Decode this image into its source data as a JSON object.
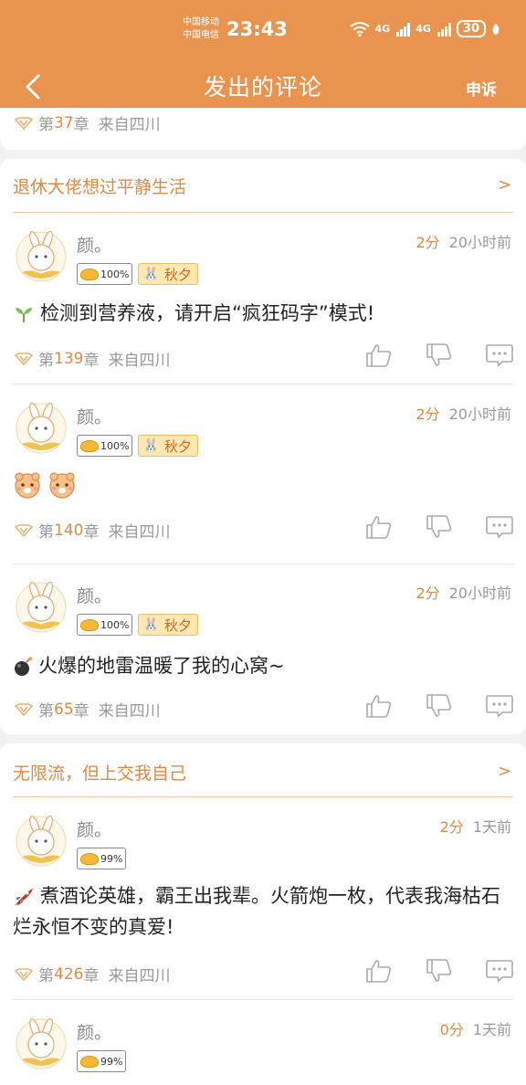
{
  "status_bar": {
    "carrier1": "中国移动",
    "carrier2": "中国电信",
    "time": "23:43",
    "net1": "4G",
    "net2": "4G",
    "battery": "30"
  },
  "header": {
    "title": "发出的评论",
    "appeal": "申诉"
  },
  "partial_top": {
    "chapter_prefix": "第",
    "chapter_num": "37",
    "chapter_suffix": "章",
    "from": "来自四川"
  },
  "groups": [
    {
      "book": "退休大佬想过平静生活",
      "chevron": ">",
      "comments": [
        {
          "user": "颜。",
          "score": "2分",
          "time": "20小时前",
          "gold": "100%",
          "rank": "秋夕",
          "text": "检测到营养液，请开启“疯狂码字”模式!",
          "chapter_prefix": "第",
          "chapter": "139",
          "chapter_suffix": "章",
          "from": "来自四川"
        },
        {
          "user": "颜。",
          "score": "2分",
          "time": "20小时前",
          "gold": "100%",
          "rank": "秋夕",
          "text": "",
          "chapter_prefix": "第",
          "chapter": "140",
          "chapter_suffix": "章",
          "from": "来自四川"
        },
        {
          "user": "颜。",
          "score": "2分",
          "time": "20小时前",
          "gold": "100%",
          "rank": "秋夕",
          "text": "火爆的地雷温暖了我的心窝~",
          "chapter_prefix": "第",
          "chapter": "65",
          "chapter_suffix": "章",
          "from": "来自四川"
        }
      ]
    },
    {
      "book": "无限流，但上交我自己",
      "chevron": ">",
      "comments": [
        {
          "user": "颜。",
          "score": "2分",
          "time": "1天前",
          "gold": "99%",
          "text": "煮酒论英雄，霸王出我辈。火箭炮一枚，代表我海枯石烂永恒不变的真爱!",
          "chapter_prefix": "第",
          "chapter": "426",
          "chapter_suffix": "章",
          "from": "来自四川"
        },
        {
          "user": "颜。",
          "score": "0分",
          "time": "1天前",
          "gold": "99%"
        }
      ]
    }
  ]
}
